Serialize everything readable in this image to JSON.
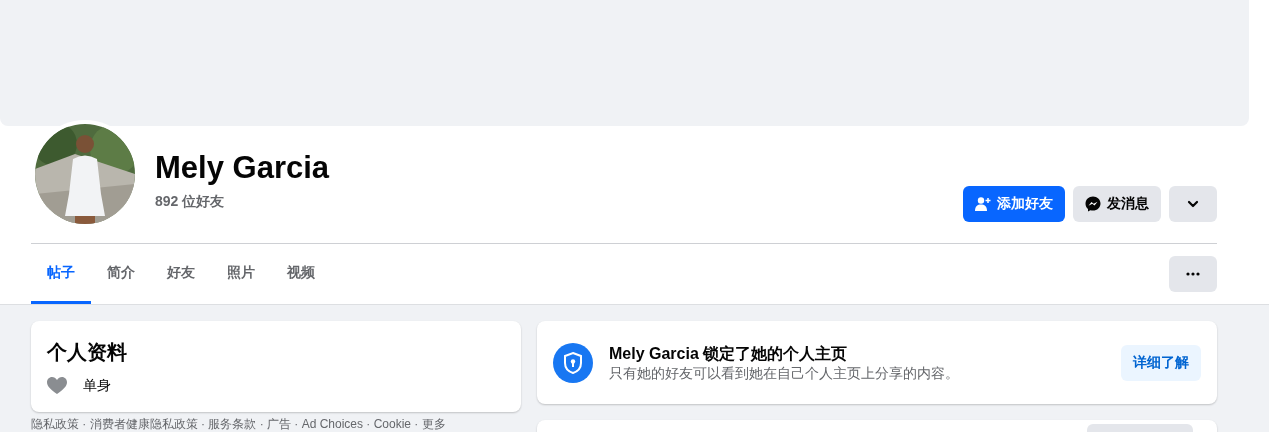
{
  "profile": {
    "name": "Mely Garcia",
    "friends_count": "892 位好友"
  },
  "actions": [
    {
      "kind": "add",
      "label": "添加好友"
    },
    {
      "kind": "message",
      "label": "发消息"
    },
    {
      "kind": "dropdown"
    }
  ],
  "tabs": [
    {
      "label": "帖子",
      "selected": true
    },
    {
      "label": "简介",
      "selected": false
    },
    {
      "label": "好友",
      "selected": false
    },
    {
      "label": "照片",
      "selected": false
    },
    {
      "label": "视频",
      "selected": false
    }
  ],
  "intro": {
    "title": "个人资料",
    "items": [
      {
        "kind": "relationship",
        "text": "单身"
      }
    ]
  },
  "footer_text": "隐私政策 · 消费者健康隐私政策 · 服务条款 · 广告 · Ad Choices · Cookie · 更多",
  "lock_notice": {
    "title": "Mely Garcia 锁定了她的个人主页",
    "text": "只有她的好友可以看到她在自己个人主页上分享的内容。",
    "button": "详细了解"
  }
}
